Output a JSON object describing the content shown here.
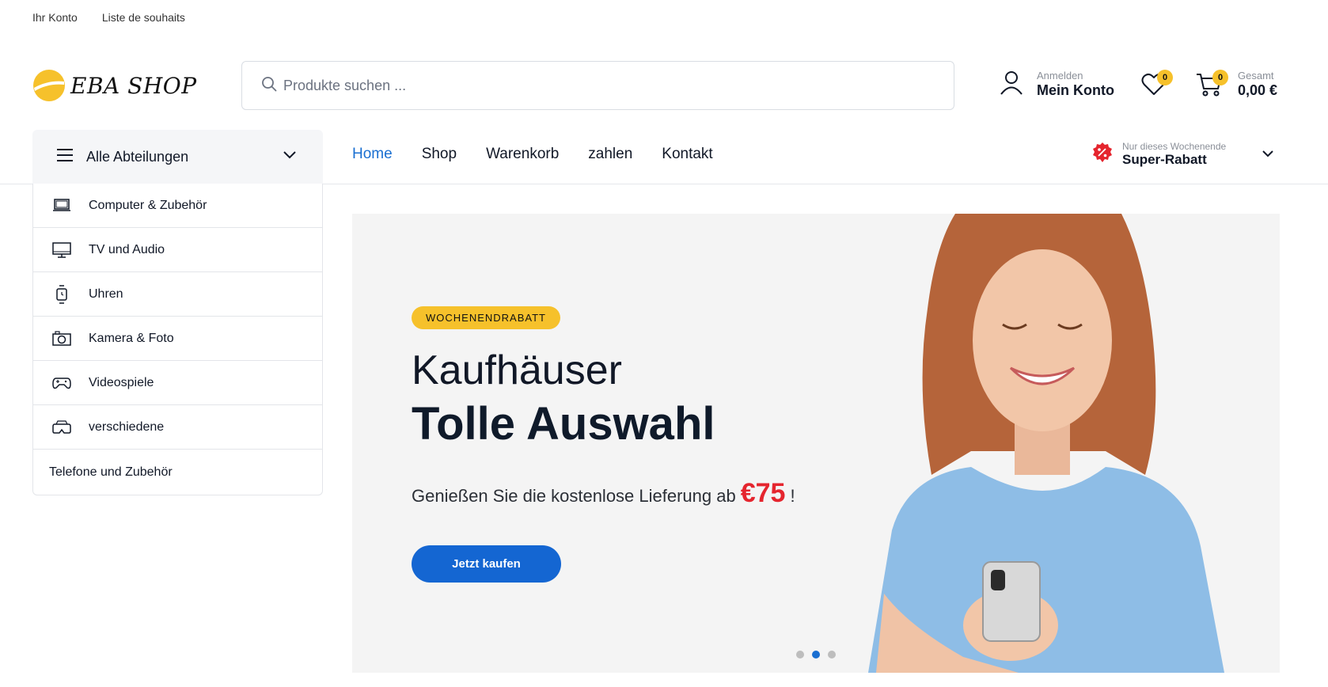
{
  "topbar": {
    "links": [
      "Ihr Konto",
      "Liste de souhaits"
    ]
  },
  "logo": {
    "brand_text": "EBA SHOP",
    "accent_color": "#f6c12b"
  },
  "search": {
    "placeholder": "Produkte suchen ...",
    "icon": "search-icon"
  },
  "account": {
    "small": "Anmelden",
    "big": "Mein Konto",
    "icon": "user-icon"
  },
  "wishlist": {
    "count": "0",
    "icon": "heart-icon"
  },
  "cart": {
    "count": "0",
    "small": "Gesamt",
    "total": "0,00 €",
    "icon": "cart-icon"
  },
  "departments": {
    "label": "Alle Abteilungen",
    "items": [
      {
        "label": "Computer & Zubehör",
        "icon": "laptop-icon"
      },
      {
        "label": "TV und Audio",
        "icon": "monitor-icon"
      },
      {
        "label": "Uhren",
        "icon": "watch-icon"
      },
      {
        "label": "Kamera & Foto",
        "icon": "camera-icon"
      },
      {
        "label": "Videospiele",
        "icon": "gamepad-icon"
      },
      {
        "label": "verschiedene",
        "icon": "vr-headset-icon"
      },
      {
        "label": "Telefone und Zubehör",
        "icon": ""
      }
    ]
  },
  "mainnav": {
    "items": [
      "Home",
      "Shop",
      "Warenkorb",
      "zahlen",
      "Kontakt"
    ],
    "active": "Home"
  },
  "promo": {
    "small": "Nur dieses Wochenende",
    "big": "Super-Rabatt",
    "icon": "discount-badge-icon"
  },
  "hero": {
    "tag": "WOCHENENDRABATT",
    "title_line1": "Kaufhäuser",
    "title_line2": "Tolle Auswahl",
    "subtitle": "Genießen Sie die kostenlose Lieferung ab",
    "price": "€75",
    "subtitle_end": "!",
    "button": "Jetzt kaufen",
    "slides": 3,
    "active_slide": 2
  },
  "colors": {
    "primary": "#1466d2",
    "accent": "#f6c12b",
    "price_red": "#e5252e"
  }
}
